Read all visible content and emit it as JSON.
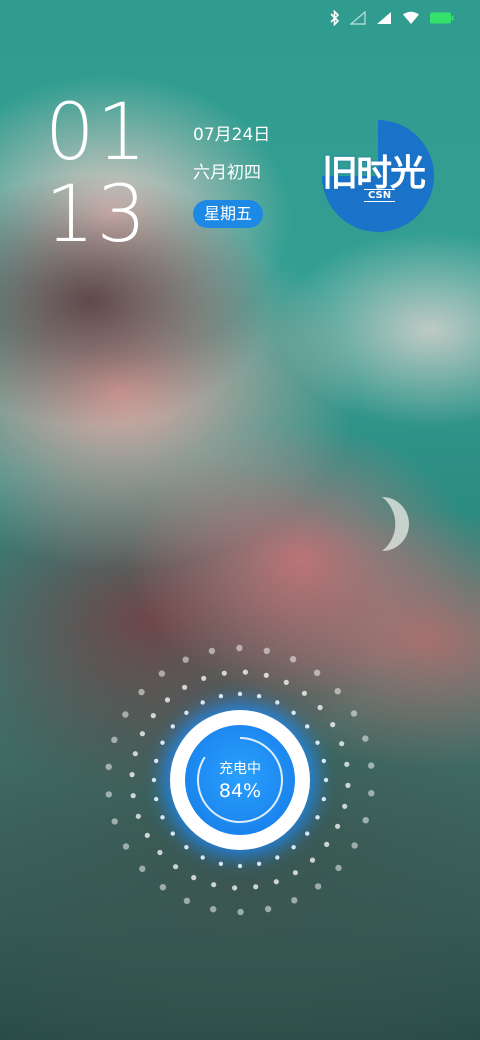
{
  "status_bar": {
    "icons": [
      "bluetooth-icon",
      "signal-empty-icon",
      "signal-full-icon",
      "wifi-icon",
      "battery-icon"
    ],
    "battery_color": "#35e06b"
  },
  "clock": {
    "hours": "01",
    "minutes": "13"
  },
  "date": {
    "gregorian": "07月24日",
    "lunar": "六月初四",
    "weekday": "星期五",
    "pill_color": "#1e88e5"
  },
  "logo": {
    "title": "旧时光",
    "subtitle": "CSN",
    "color": "#1a73c8"
  },
  "charging": {
    "label": "充电中",
    "percent": "84%",
    "level": 0.84,
    "accent": "#1e88e5"
  }
}
